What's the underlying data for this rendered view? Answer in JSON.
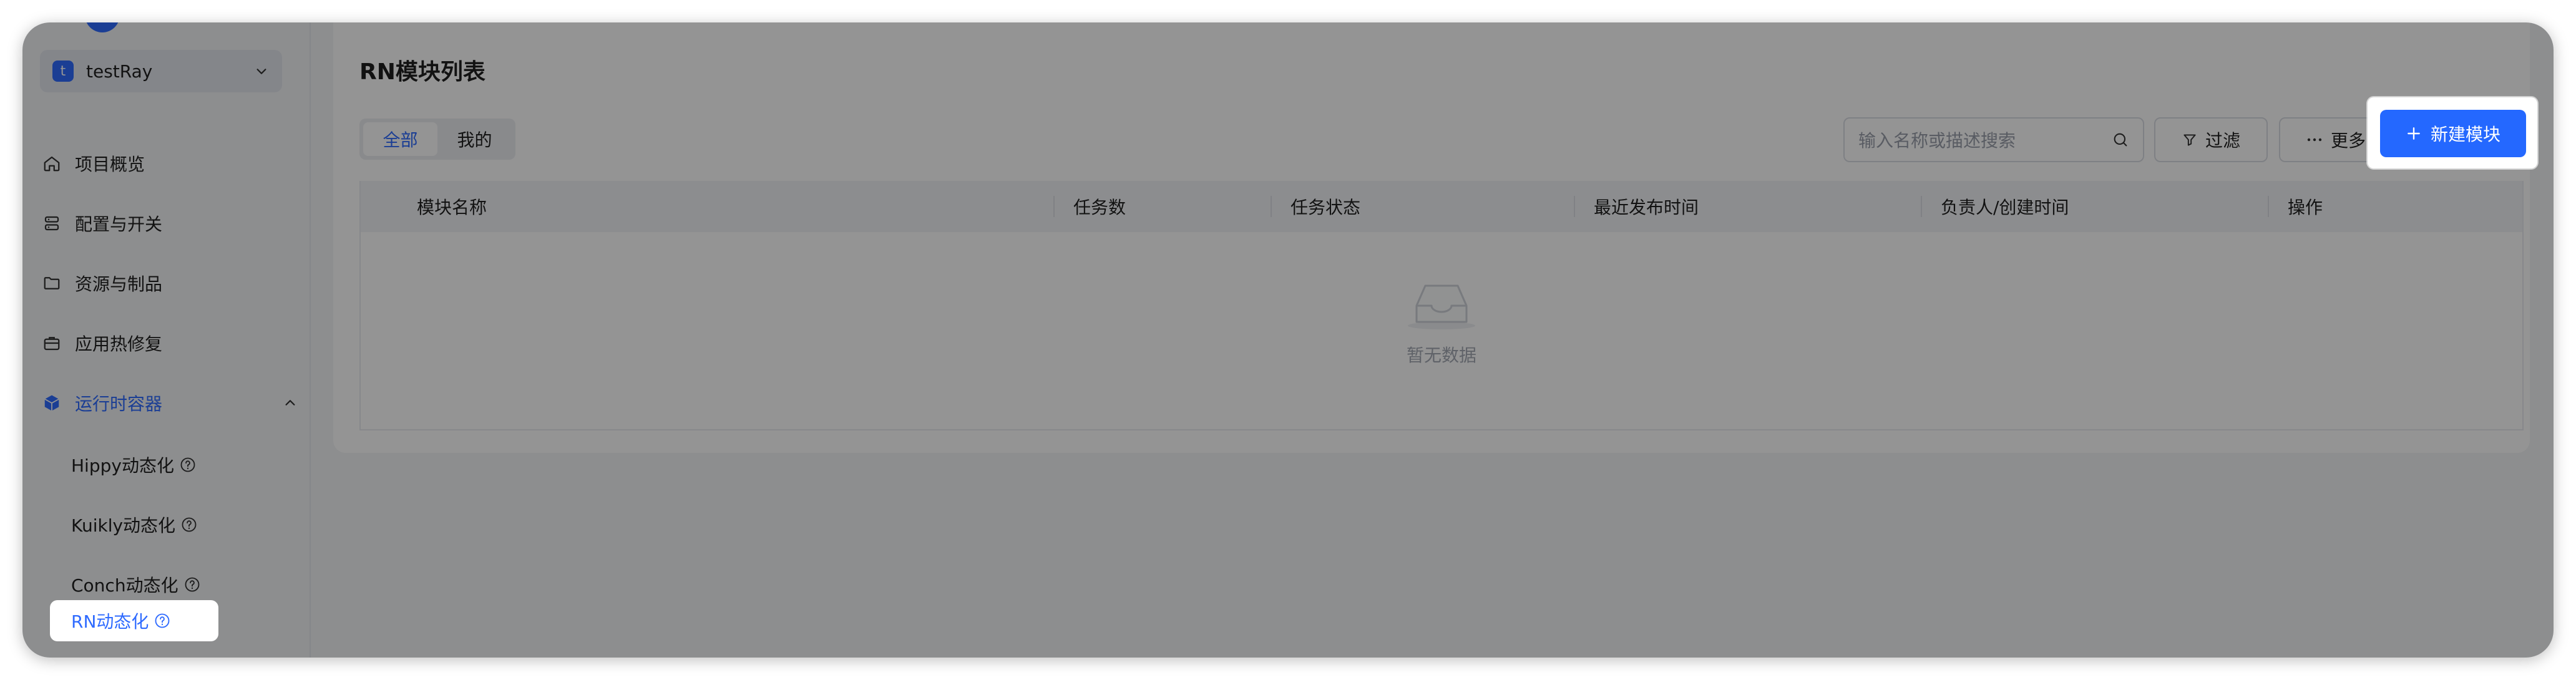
{
  "sidebar": {
    "project": {
      "avatar_letter": "t",
      "name": "testRay"
    },
    "items": [
      {
        "label": "项目概览",
        "icon": "home-icon"
      },
      {
        "label": "配置与开关",
        "icon": "config-icon"
      },
      {
        "label": "资源与制品",
        "icon": "folder-icon"
      },
      {
        "label": "应用热修复",
        "icon": "toolbox-icon"
      },
      {
        "label": "运行时容器",
        "icon": "cube-icon",
        "expanded": true
      }
    ],
    "sub_items": [
      {
        "label": "Hippy动态化"
      },
      {
        "label": "Kuikly动态化"
      },
      {
        "label": "Conch动态化"
      },
      {
        "label": "RN动态化",
        "selected": true
      }
    ]
  },
  "main": {
    "title": "RN模块列表",
    "tabs": [
      {
        "label": "全部",
        "active": true
      },
      {
        "label": "我的",
        "active": false
      }
    ],
    "search": {
      "placeholder": "输入名称或描述搜索"
    },
    "filter_label": "过滤",
    "more_label": "更多",
    "create_label": "新建模块",
    "table": {
      "columns": [
        "模块名称",
        "任务数",
        "任务状态",
        "最近发布时间",
        "负责人/创建时间",
        "操作"
      ],
      "empty_text": "暂无数据"
    }
  },
  "colors": {
    "accent": "#2468ff",
    "overlay": "rgba(0,0,0,0.42)"
  }
}
